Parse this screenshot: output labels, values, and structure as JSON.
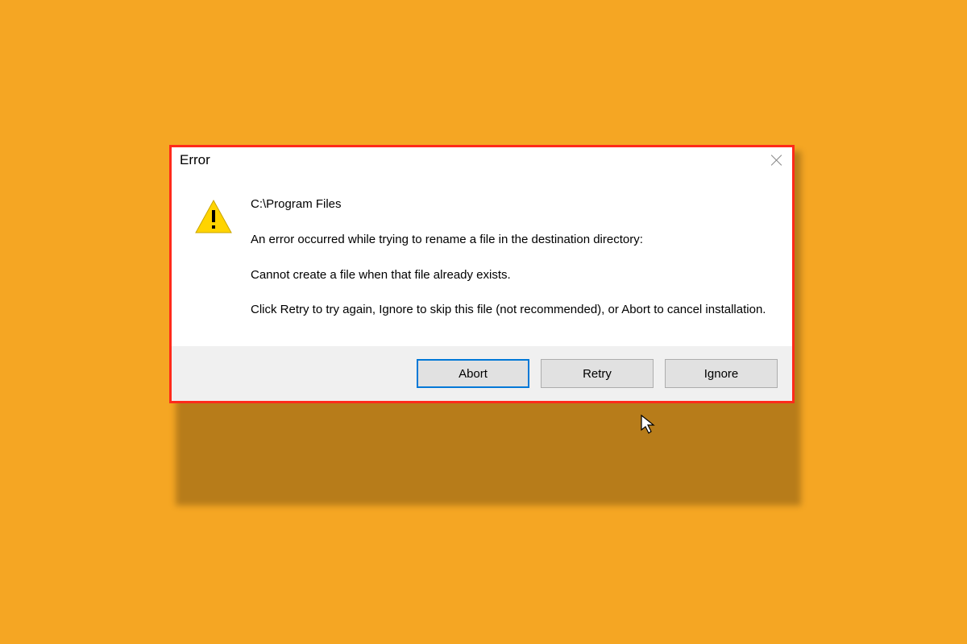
{
  "dialog": {
    "title": "Error",
    "path": "C:\\Program Files",
    "message1": "An error occurred while trying to rename a file in the destination directory:",
    "message2": "Cannot create a file when that file already exists.",
    "message3": "Click Retry to try again, Ignore to skip this file (not recommended), or Abort to cancel installation.",
    "buttons": {
      "abort": "Abort",
      "retry": "Retry",
      "ignore": "Ignore"
    }
  },
  "colors": {
    "background": "#f5a623",
    "border": "#ff2a1a",
    "primary_outline": "#0078d7"
  }
}
